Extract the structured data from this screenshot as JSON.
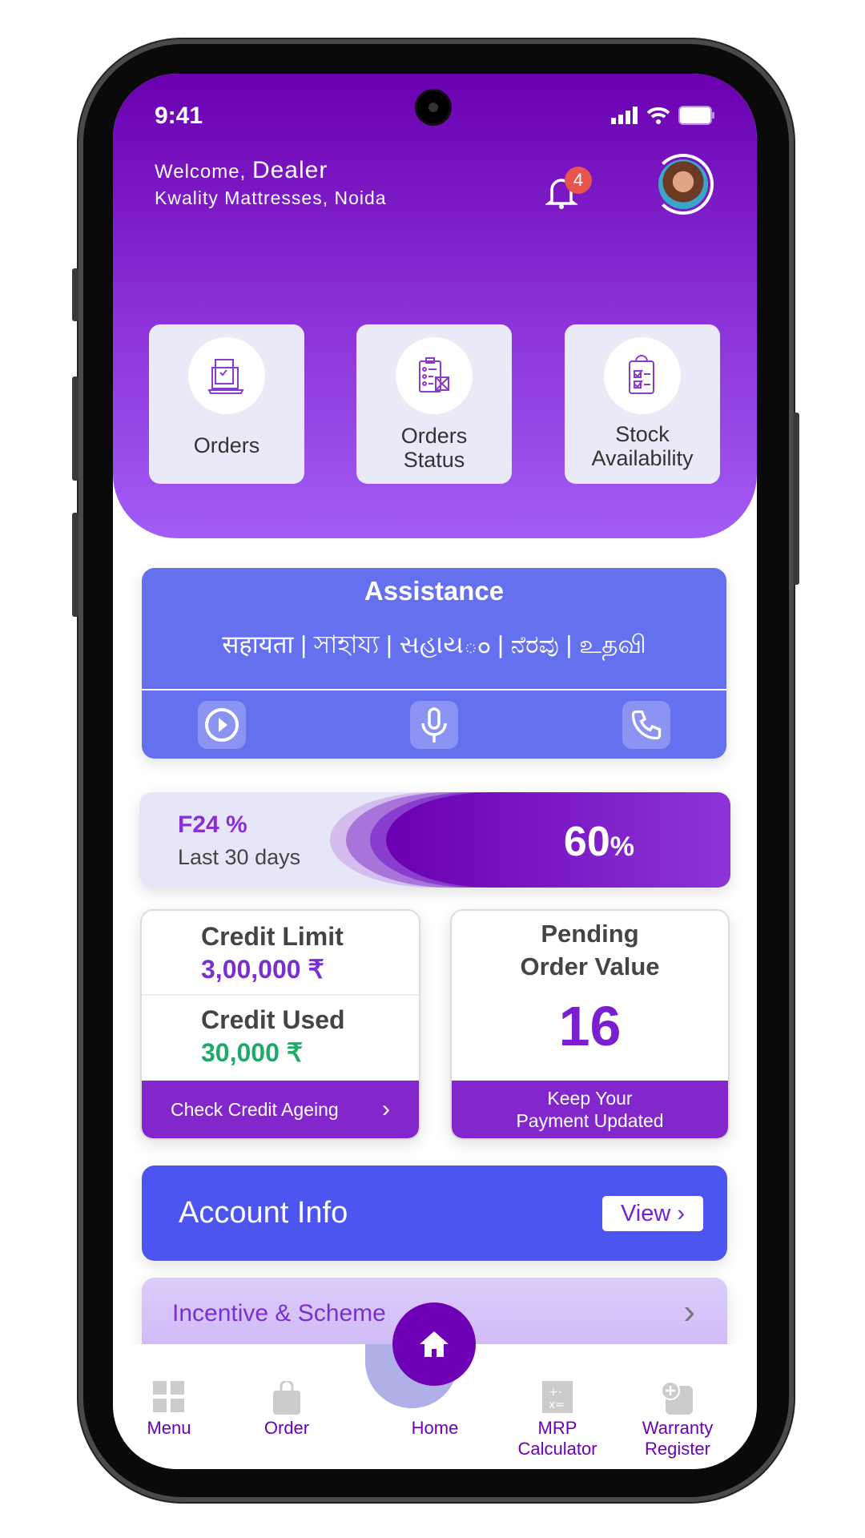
{
  "status_bar": {
    "time": "9:41"
  },
  "header": {
    "welcome": "Welcome,",
    "user": "Dealer",
    "shop": "Kwality Mattresses, Noida",
    "notification_count": "4"
  },
  "tiles": [
    {
      "label": "Orders",
      "icon": "laptop-order-icon"
    },
    {
      "label": "Orders Status",
      "icon": "clipboard-gift-icon"
    },
    {
      "label": "Stock Availability",
      "icon": "clipboard-check-icon"
    }
  ],
  "assistance": {
    "title": "Assistance",
    "languages": "सहायता | সাহায্য | સહાયం | ನೆರವು | உதவி",
    "actions": [
      "play-icon",
      "microphone-icon",
      "phone-icon"
    ]
  },
  "f24": {
    "title": "F24 %",
    "subtitle": "Last 30 days",
    "value": "60",
    "unit": "%"
  },
  "credit": {
    "limit_label": "Credit Limit",
    "limit_value": "3,00,000 ₹",
    "used_label": "Credit Used",
    "used_value": "30,000 ₹",
    "button": "Check Credit Ageing"
  },
  "pending": {
    "label": "Pending Order Value",
    "value": "16",
    "note_line1": "Keep Your",
    "note_line2": "Payment Updated"
  },
  "account": {
    "title": "Account Info",
    "view": "View"
  },
  "incentive": {
    "title": "Incentive & Scheme"
  },
  "nav": {
    "items": [
      {
        "label": "Menu"
      },
      {
        "label": "Order"
      },
      {
        "label": "Home"
      },
      {
        "label": "MRP Calculator"
      },
      {
        "label": "Warranty Register"
      }
    ]
  },
  "colors": {
    "primary": "#6e00b5",
    "accent_blue": "#4c55f0",
    "assist_blue": "#6470ee",
    "green": "#1faa6a"
  }
}
